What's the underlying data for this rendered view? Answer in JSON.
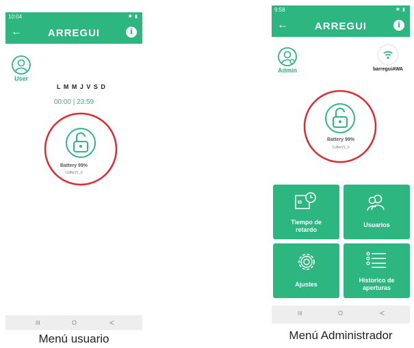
{
  "user_screen": {
    "status_time": "10:04",
    "app_title": "ARREGUI",
    "user_label": "User",
    "days": "L M M J V S D",
    "schedule": "00:00 | 23:59",
    "battery": "Battery 99%",
    "device_id": "CofferV1_0",
    "nav": [
      "III",
      "O",
      "<"
    ],
    "caption": "Menú usuario"
  },
  "admin_screen": {
    "status_time": "9:58",
    "app_title": "ARREGUI",
    "admin_label": "Admin",
    "wifi_label": "barreguiAWA",
    "battery": "Battery 99%",
    "device_id": "CofferV1_0",
    "tiles": [
      {
        "label_line1": "Tiempo de",
        "label_line2": "retardo",
        "icon": "clock-box-icon"
      },
      {
        "label_line1": "Usuarios",
        "label_line2": "",
        "icon": "users-icon"
      },
      {
        "label_line1": "Ajustes",
        "label_line2": "",
        "icon": "gear-icon"
      },
      {
        "label_line1": "Historico de",
        "label_line2": "aperturas",
        "icon": "list-icon"
      }
    ],
    "nav": [
      "III",
      "O",
      "<"
    ],
    "caption": "Menú Administrador"
  },
  "colors": {
    "accent": "#2db67f",
    "highlight": "#e2282e"
  }
}
